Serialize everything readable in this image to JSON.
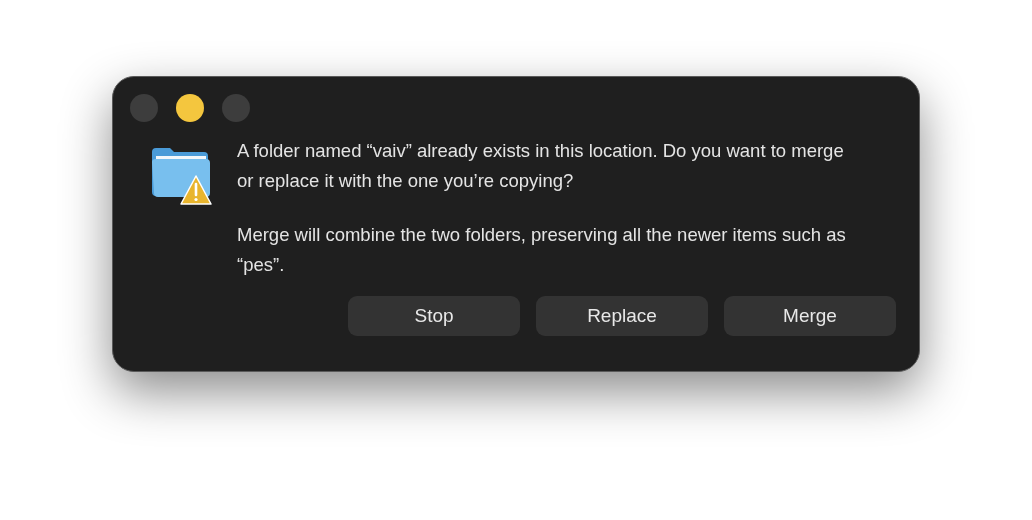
{
  "window_controls": [
    {
      "color": "#3d3d3d"
    },
    {
      "color": "#f4c63e"
    },
    {
      "color": "#3d3d3d"
    }
  ],
  "message": "A folder named “vaiv” already exists in this location. Do you want to merge or replace it with the one you’re copying?",
  "detail": "Merge will combine the two folders, preserving all the newer items such as “pes”.",
  "buttons": [
    "Stop",
    "Replace",
    "Merge"
  ]
}
